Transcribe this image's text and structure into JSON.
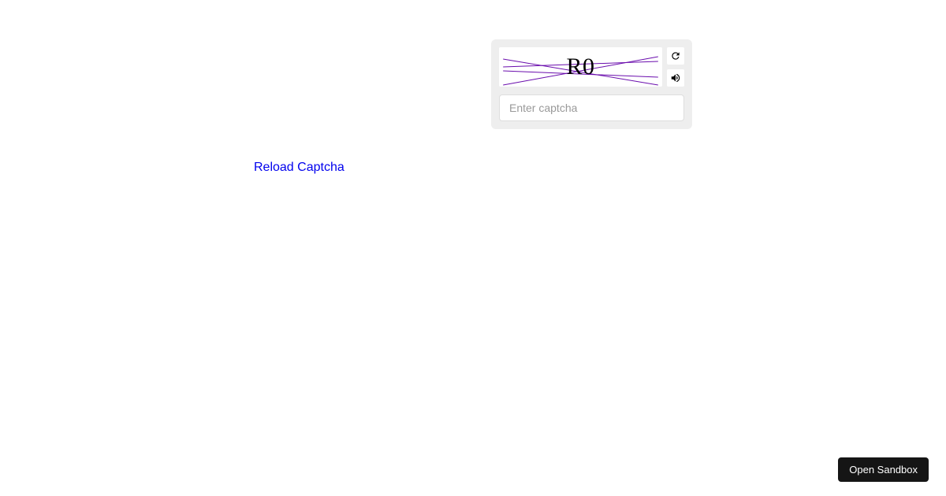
{
  "captcha": {
    "text": "R0",
    "input_placeholder": "Enter captcha",
    "line_color": "#6a0dad"
  },
  "reload_link": "Reload Captcha",
  "sandbox_button": "Open Sandbox"
}
